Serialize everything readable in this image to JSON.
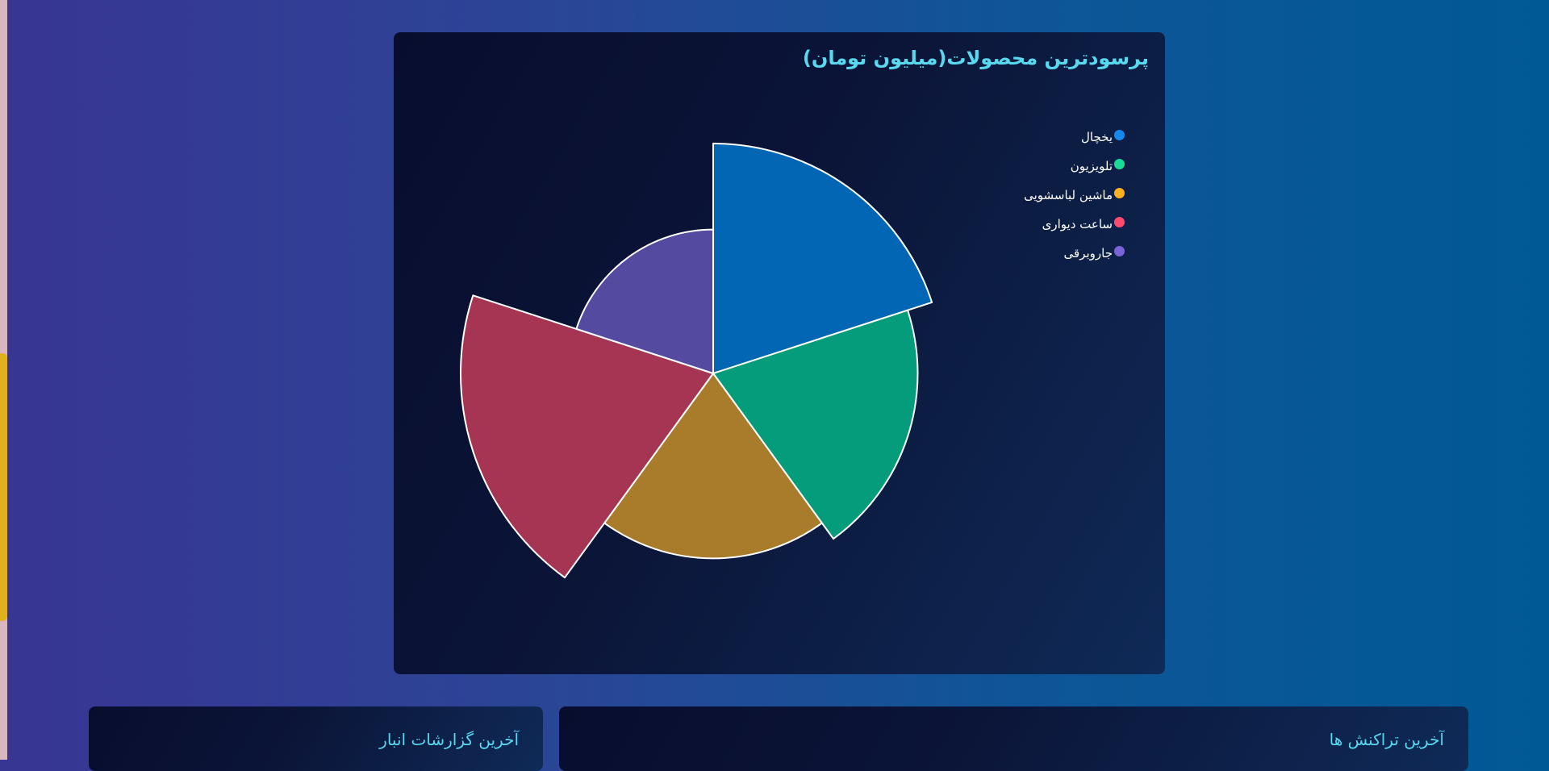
{
  "colors": {
    "title": "#58d9f0",
    "slice_stroke": "#ffffff"
  },
  "chart_data": {
    "type": "polar-area",
    "title": "پرسودترین محصولات(میلیون تومان)",
    "legend_placement": "top-right",
    "categories": [
      "یخچال",
      "تلویزیون",
      "ماشین لباسشویی",
      "ساعت دیواری",
      "جاروبرقی"
    ],
    "values": [
      258,
      204,
      167,
      311,
      101
    ],
    "colors": [
      "#0366b5",
      "#049c7b",
      "#a87c2b",
      "#a63553",
      "#544aa0"
    ],
    "legend_colors": [
      "#1588ee",
      "#1adb96",
      "#ffb020",
      "#ff4a6e",
      "#7a63d6"
    ]
  },
  "cards": {
    "warehouse_title": "آخرین گزارشات انبار",
    "transactions_title": "آخرین تراکنش ها"
  }
}
